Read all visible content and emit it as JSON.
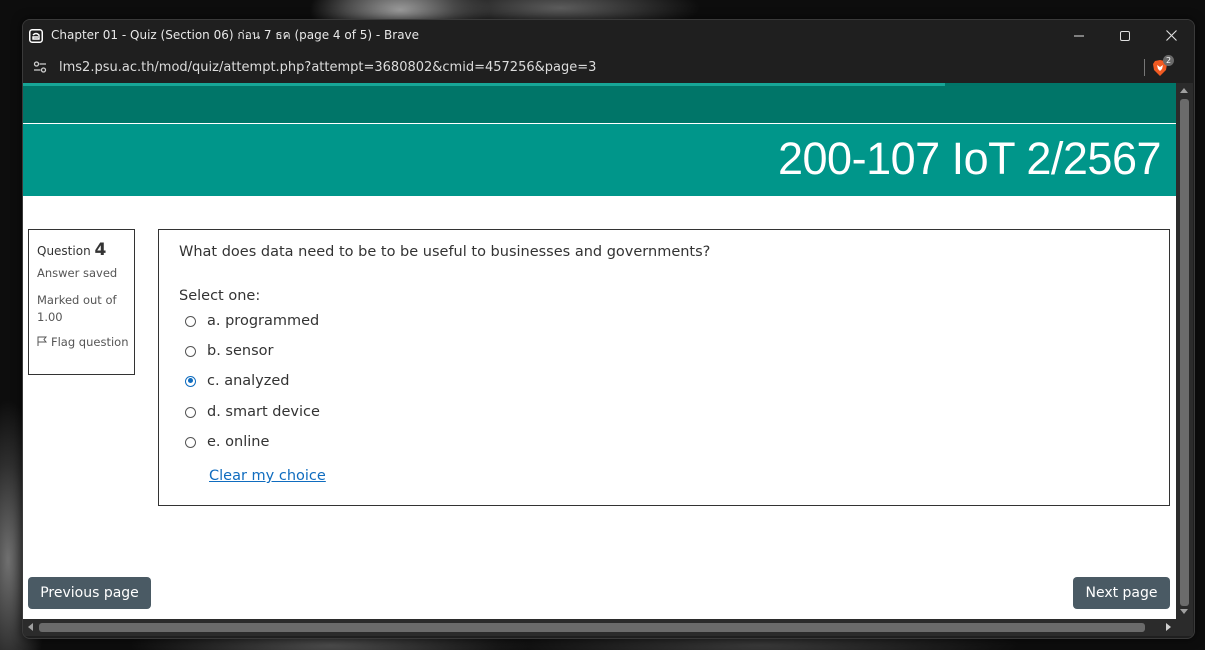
{
  "window": {
    "title": "Chapter 01 - Quiz (Section 06) ก่อน 7 ธค (page 4 of 5) - Brave",
    "url": "lms2.psu.ac.th/mod/quiz/attempt.php?attempt=3680802&cmid=457256&page=3",
    "brave_badge": "2"
  },
  "page": {
    "load_progress": 0.8,
    "banner_title": "200-107 IoT 2/2567"
  },
  "question_info": {
    "label": "Question",
    "number": "4",
    "state": "Answer saved",
    "grade": "Marked out of 1.00",
    "flag": "Flag question"
  },
  "question": {
    "text": "What does data need to be to be useful to businesses and governments?",
    "prompt": "Select one:",
    "answers": [
      {
        "label": "a. programmed",
        "selected": false
      },
      {
        "label": "b. sensor",
        "selected": false
      },
      {
        "label": "c. analyzed",
        "selected": true
      },
      {
        "label": "d. smart device",
        "selected": false
      },
      {
        "label": "e. online",
        "selected": false
      }
    ],
    "clear_label": "Clear my choice"
  },
  "navigation": {
    "previous_label": "Previous page",
    "next_label": "Next page"
  },
  "colors": {
    "nav_band": "#007568",
    "banner": "#00968a",
    "button": "#4a5a64",
    "link": "#0f6cbf"
  }
}
